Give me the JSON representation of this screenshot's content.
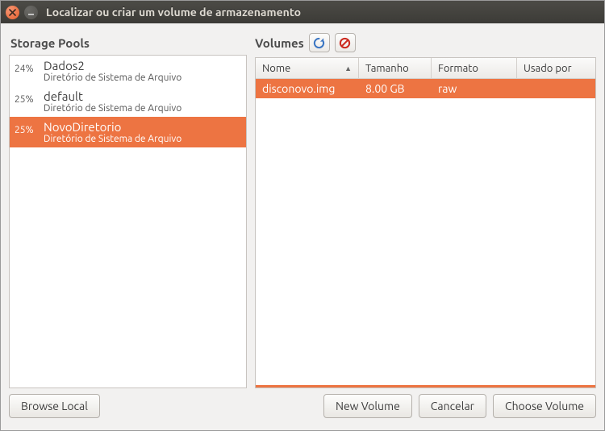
{
  "window": {
    "title": "Localizar ou criar um volume de armazenamento"
  },
  "left": {
    "title": "Storage Pools",
    "pools": [
      {
        "pct": "24%",
        "name": "Dados2",
        "sub": "Diretório de Sistema de Arquivo",
        "selected": false
      },
      {
        "pct": "25%",
        "name": "default",
        "sub": "Diretório de Sistema de Arquivo",
        "selected": false
      },
      {
        "pct": "25%",
        "name": "NovoDiretorio",
        "sub": "Diretório de Sistema de Arquivo",
        "selected": true
      }
    ]
  },
  "right": {
    "title": "Volumes",
    "columns": {
      "nome": "Nome",
      "tamanho": "Tamanho",
      "formato": "Formato",
      "usado": "Usado por"
    },
    "rows": [
      {
        "nome": "disconovo.img",
        "tamanho": "8.00 GB",
        "formato": "raw",
        "usado": "",
        "selected": true
      }
    ]
  },
  "footer": {
    "browse": "Browse Local",
    "new_volume": "New Volume",
    "cancel": "Cancelar",
    "choose": "Choose Volume"
  }
}
